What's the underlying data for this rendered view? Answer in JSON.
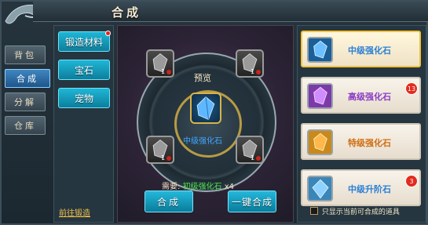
{
  "window": {
    "title": "合成"
  },
  "sidebar": {
    "tabs": [
      {
        "label": "背包"
      },
      {
        "label": "合成",
        "active": true
      },
      {
        "label": "分解"
      },
      {
        "label": "仓库"
      }
    ]
  },
  "categories": [
    {
      "label": "锻造材料",
      "has_notice": true
    },
    {
      "label": "宝石"
    },
    {
      "label": "宠物"
    }
  ],
  "footer_link": "前往锻造",
  "preview": {
    "label": "预览",
    "result_name": "中级强化石",
    "input_slots": [
      {
        "count": "1"
      },
      {
        "count": "1"
      },
      {
        "count": "1"
      },
      {
        "count": "1"
      }
    ],
    "requirement_prefix": "需要:",
    "requirement_item": "初级强化石",
    "requirement_count": "x4"
  },
  "buttons": {
    "combine": "合成",
    "combine_all": "一键合成"
  },
  "recipes": [
    {
      "name": "中级强化石",
      "name_color": "#2a7fd6",
      "icon_color": "#1a5f96",
      "selected": true,
      "badge": ""
    },
    {
      "name": "高级强化石",
      "name_color": "#8a3cc4",
      "icon_color": "#7a3aa8",
      "selected": false,
      "badge": "13"
    },
    {
      "name": "特级强化石",
      "name_color": "#d06d12",
      "icon_color": "#c98a1a",
      "selected": false,
      "badge": ""
    },
    {
      "name": "中级升阶石",
      "name_color": "#2a7fd6",
      "icon_color": "#3b86b8",
      "selected": false,
      "badge": "3"
    }
  ],
  "filter": {
    "label": "只显示当前可合成的道具",
    "checked": false
  }
}
